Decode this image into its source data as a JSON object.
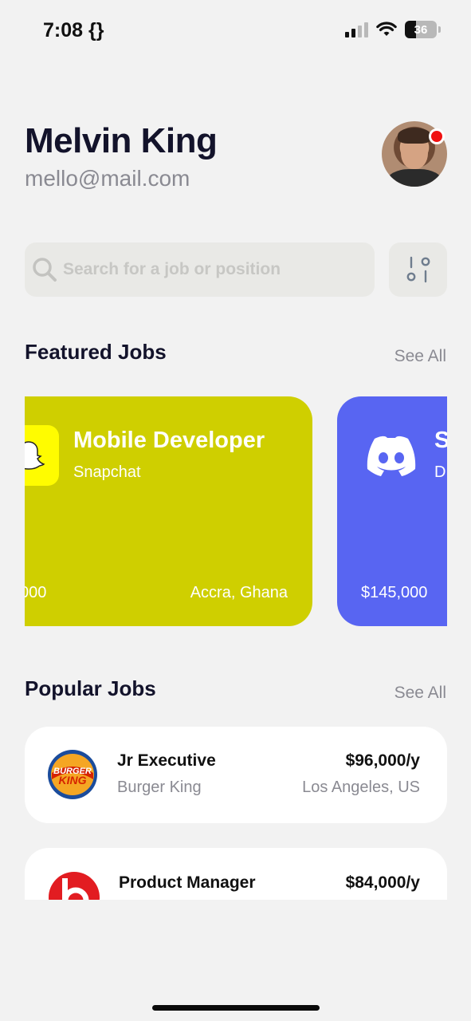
{
  "status": {
    "time": "7:08 {}",
    "battery": "36",
    "battery_level": 0.36
  },
  "profile": {
    "name": "Melvin King",
    "email": "mello@mail.com",
    "has_notification": true
  },
  "search": {
    "placeholder": "Search for a job or position"
  },
  "featured": {
    "title": "Featured Jobs",
    "see_all": "See All",
    "cards": [
      {
        "title": "Mobile Developer",
        "company": "Snapchat",
        "salary": "000",
        "location": "Accra, Ghana",
        "color": "#cfcf00"
      },
      {
        "title": "S",
        "company": "D",
        "salary": "$145,000",
        "color": "#5865f2"
      }
    ]
  },
  "popular": {
    "title": "Popular Jobs",
    "see_all": "See All",
    "jobs": [
      {
        "title": "Jr Executive",
        "company": "Burger King",
        "salary": "$96,000/y",
        "location": "Los Angeles, US"
      },
      {
        "title": "Product Manager",
        "salary": "$84,000/y"
      }
    ]
  },
  "colors": {
    "accent_yellow": "#cfcf00",
    "accent_blue": "#5865f2",
    "notification_red": "#f01010"
  }
}
